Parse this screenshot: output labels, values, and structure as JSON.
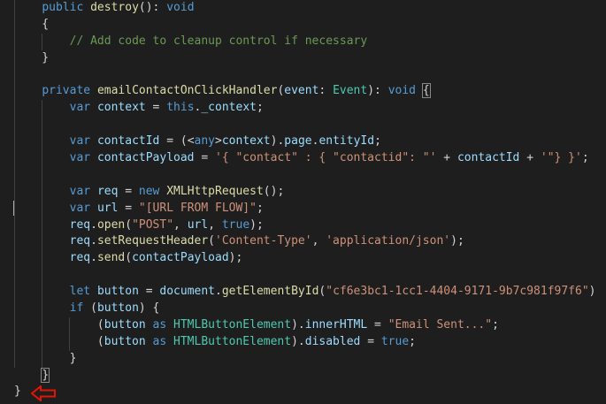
{
  "editor": {
    "language": "TypeScript",
    "theme_colors": {
      "background": "#1e1e1e",
      "keyword": "#569cd6",
      "function": "#dcdcaa",
      "variable": "#9cdcfe",
      "type": "#4ec9b0",
      "string": "#ce9178",
      "comment": "#6a9955",
      "annotation_arrow": "#e51400"
    },
    "lines": [
      [
        {
          "t": "    "
        },
        {
          "t": "public",
          "c": "kw"
        },
        {
          "t": " "
        },
        {
          "t": "destroy",
          "c": "fn"
        },
        {
          "t": "(): "
        },
        {
          "t": "void",
          "c": "kw"
        }
      ],
      [
        {
          "t": "    {"
        }
      ],
      [
        {
          "t": "        "
        },
        {
          "t": "// Add code to cleanup control if necessary",
          "c": "cmt"
        }
      ],
      [
        {
          "t": "    }"
        }
      ],
      [
        {
          "t": ""
        }
      ],
      [
        {
          "t": "    "
        },
        {
          "t": "private",
          "c": "kw"
        },
        {
          "t": " "
        },
        {
          "t": "emailContactOnClickHandler",
          "c": "fn"
        },
        {
          "t": "("
        },
        {
          "t": "event",
          "c": "var"
        },
        {
          "t": ": "
        },
        {
          "t": "Event",
          "c": "type"
        },
        {
          "t": "): "
        },
        {
          "t": "void",
          "c": "kw"
        },
        {
          "t": " "
        },
        {
          "t": "{",
          "c": "box"
        }
      ],
      [
        {
          "t": "        "
        },
        {
          "t": "var",
          "c": "kw"
        },
        {
          "t": " "
        },
        {
          "t": "context",
          "c": "var"
        },
        {
          "t": " = "
        },
        {
          "t": "this",
          "c": "kw"
        },
        {
          "t": "."
        },
        {
          "t": "_context",
          "c": "var"
        },
        {
          "t": ";"
        }
      ],
      [
        {
          "t": ""
        }
      ],
      [
        {
          "t": "        "
        },
        {
          "t": "var",
          "c": "kw"
        },
        {
          "t": " "
        },
        {
          "t": "contactId",
          "c": "var"
        },
        {
          "t": " = (<"
        },
        {
          "t": "any",
          "c": "kw"
        },
        {
          "t": ">"
        },
        {
          "t": "context",
          "c": "var"
        },
        {
          "t": ")."
        },
        {
          "t": "page",
          "c": "var"
        },
        {
          "t": "."
        },
        {
          "t": "entityId",
          "c": "var"
        },
        {
          "t": ";"
        }
      ],
      [
        {
          "t": "        "
        },
        {
          "t": "var",
          "c": "kw"
        },
        {
          "t": " "
        },
        {
          "t": "contactPayload",
          "c": "var"
        },
        {
          "t": " = "
        },
        {
          "t": "'{ \"contact\" : { \"contactid\": \"'",
          "c": "str"
        },
        {
          "t": " + "
        },
        {
          "t": "contactId",
          "c": "var"
        },
        {
          "t": " + "
        },
        {
          "t": "'\"} }'",
          "c": "str"
        },
        {
          "t": ";"
        }
      ],
      [
        {
          "t": ""
        }
      ],
      [
        {
          "t": "        "
        },
        {
          "t": "var",
          "c": "kw"
        },
        {
          "t": " "
        },
        {
          "t": "req",
          "c": "var"
        },
        {
          "t": " = "
        },
        {
          "t": "new",
          "c": "kw"
        },
        {
          "t": " "
        },
        {
          "t": "XMLHttpRequest",
          "c": "fn"
        },
        {
          "t": "();"
        }
      ],
      [
        {
          "t": "        "
        },
        {
          "t": "var",
          "c": "kw"
        },
        {
          "t": " "
        },
        {
          "t": "url",
          "c": "var"
        },
        {
          "t": " = "
        },
        {
          "t": "\"[URL FROM FLOW]\"",
          "c": "str"
        },
        {
          "t": ";"
        }
      ],
      [
        {
          "t": "        "
        },
        {
          "t": "req",
          "c": "var"
        },
        {
          "t": "."
        },
        {
          "t": "open",
          "c": "fn"
        },
        {
          "t": "("
        },
        {
          "t": "\"POST\"",
          "c": "str"
        },
        {
          "t": ", "
        },
        {
          "t": "url",
          "c": "var"
        },
        {
          "t": ", "
        },
        {
          "t": "true",
          "c": "kw"
        },
        {
          "t": ");"
        }
      ],
      [
        {
          "t": "        "
        },
        {
          "t": "req",
          "c": "var"
        },
        {
          "t": "."
        },
        {
          "t": "setRequestHeader",
          "c": "fn"
        },
        {
          "t": "("
        },
        {
          "t": "'Content-Type'",
          "c": "str"
        },
        {
          "t": ", "
        },
        {
          "t": "'application/json'",
          "c": "str"
        },
        {
          "t": ");"
        }
      ],
      [
        {
          "t": "        "
        },
        {
          "t": "req",
          "c": "var"
        },
        {
          "t": "."
        },
        {
          "t": "send",
          "c": "fn"
        },
        {
          "t": "("
        },
        {
          "t": "contactPayload",
          "c": "var"
        },
        {
          "t": ");"
        }
      ],
      [
        {
          "t": ""
        }
      ],
      [
        {
          "t": "        "
        },
        {
          "t": "let",
          "c": "kw"
        },
        {
          "t": " "
        },
        {
          "t": "button",
          "c": "var"
        },
        {
          "t": " = "
        },
        {
          "t": "document",
          "c": "var"
        },
        {
          "t": "."
        },
        {
          "t": "getElementById",
          "c": "fn"
        },
        {
          "t": "("
        },
        {
          "t": "\"cf6e3bc1-1cc1-4404-9171-9b7c981f97f6\"",
          "c": "str"
        },
        {
          "t": ")"
        }
      ],
      [
        {
          "t": "        "
        },
        {
          "t": "if",
          "c": "kw"
        },
        {
          "t": " ("
        },
        {
          "t": "button",
          "c": "var"
        },
        {
          "t": ") {"
        }
      ],
      [
        {
          "t": "            ("
        },
        {
          "t": "button",
          "c": "var"
        },
        {
          "t": " "
        },
        {
          "t": "as",
          "c": "kw"
        },
        {
          "t": " "
        },
        {
          "t": "HTMLButtonElement",
          "c": "type"
        },
        {
          "t": ")."
        },
        {
          "t": "innerHTML",
          "c": "var"
        },
        {
          "t": " = "
        },
        {
          "t": "\"Email Sent...\"",
          "c": "str"
        },
        {
          "t": ";"
        }
      ],
      [
        {
          "t": "            ("
        },
        {
          "t": "button",
          "c": "var"
        },
        {
          "t": " "
        },
        {
          "t": "as",
          "c": "kw"
        },
        {
          "t": " "
        },
        {
          "t": "HTMLButtonElement",
          "c": "type"
        },
        {
          "t": ")."
        },
        {
          "t": "disabled",
          "c": "var"
        },
        {
          "t": " = "
        },
        {
          "t": "true",
          "c": "kw"
        },
        {
          "t": ";"
        }
      ],
      [
        {
          "t": "        }"
        }
      ],
      [
        {
          "t": "    "
        },
        {
          "t": "}",
          "c": "box"
        }
      ],
      [
        {
          "t": "}"
        }
      ]
    ]
  }
}
